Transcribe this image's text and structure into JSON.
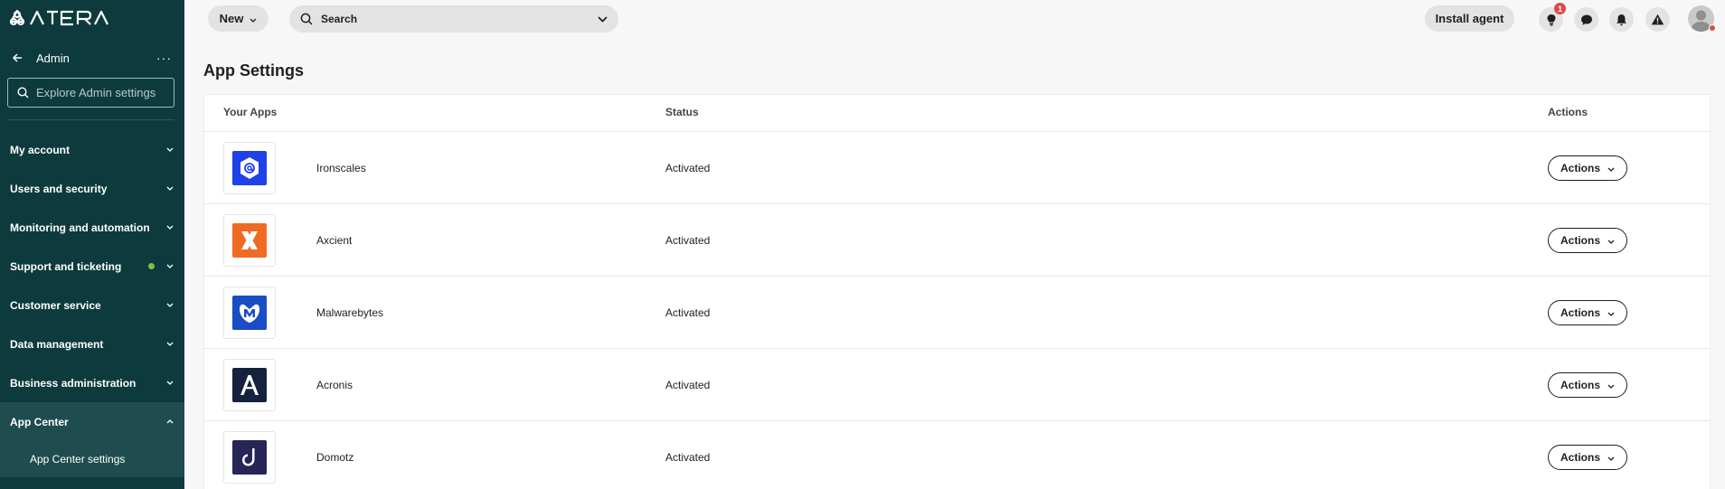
{
  "brand": {
    "logo_text": "ATERA"
  },
  "sidebar": {
    "title": "Admin",
    "more": "···",
    "search_placeholder": "Explore Admin settings",
    "items": [
      {
        "label": "My account",
        "expanded": false
      },
      {
        "label": "Users and security",
        "expanded": false
      },
      {
        "label": "Monitoring and automation",
        "expanded": false
      },
      {
        "label": "Support and ticketing",
        "expanded": false,
        "status_dot": "#7cc243"
      },
      {
        "label": "Customer service",
        "expanded": false
      },
      {
        "label": "Data management",
        "expanded": false
      },
      {
        "label": "Business administration",
        "expanded": false
      },
      {
        "label": "App Center",
        "expanded": true
      }
    ],
    "sub_items": [
      {
        "label": "App Center settings"
      }
    ]
  },
  "topbar": {
    "new_label": "New",
    "search_placeholder": "Search",
    "install_label": "Install agent",
    "tips_badge": "1"
  },
  "page": {
    "title": "App Settings"
  },
  "table": {
    "columns": [
      "Your Apps",
      "Status",
      "Actions"
    ],
    "rows": [
      {
        "name": "Ironscales",
        "status": "Activated",
        "action": "Actions",
        "logo_color": "#1f42e8",
        "logo_icon": "email-shield-icon"
      },
      {
        "name": "Axcient",
        "status": "Activated",
        "action": "Actions",
        "logo_color": "#f06a24",
        "logo_icon": "axcient-x-icon"
      },
      {
        "name": "Malwarebytes",
        "status": "Activated",
        "action": "Actions",
        "logo_color": "#1a4cc4",
        "logo_icon": "malwarebytes-m-icon"
      },
      {
        "name": "Acronis",
        "status": "Activated",
        "action": "Actions",
        "logo_color": "#16213f",
        "logo_icon": "acronis-a-icon"
      },
      {
        "name": "Domotz",
        "status": "Activated",
        "action": "Actions",
        "logo_color": "#272556",
        "logo_icon": "domotz-d-icon"
      }
    ]
  },
  "colors": {
    "sidebar_bg": "#0d3b3d",
    "sidebar_active": "#1f4c4e",
    "alert_red": "#e04848"
  }
}
